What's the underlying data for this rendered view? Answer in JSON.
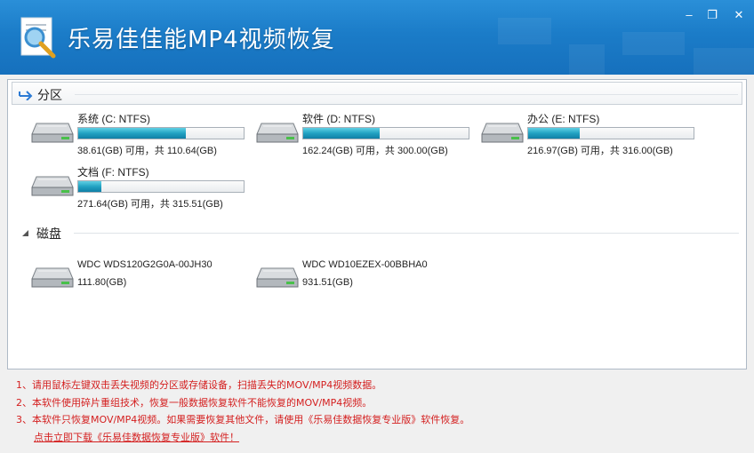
{
  "window": {
    "title": "乐易佳佳能MP4视频恢复",
    "minimize": "‒",
    "restore": "❐",
    "close": "✕",
    "colors": {
      "titlebar": "#1b7cc8",
      "bar_fill": "#22a2c2",
      "note_text": "#d42020"
    }
  },
  "partitions_group": {
    "label": "分区",
    "icon": "arrow-right-icon"
  },
  "partitions": [
    {
      "name": "系统 (C: NTFS)",
      "info": "38.61(GB) 可用，共 110.64(GB)",
      "used_fraction": 0.65
    },
    {
      "name": "软件 (D: NTFS)",
      "info": "162.24(GB) 可用，共 300.00(GB)",
      "used_fraction": 0.46
    },
    {
      "name": "办公 (E: NTFS)",
      "info": "216.97(GB) 可用，共 316.00(GB)",
      "used_fraction": 0.31
    },
    {
      "name": "文档 (F: NTFS)",
      "info": "271.64(GB) 可用，共 315.51(GB)",
      "used_fraction": 0.14
    }
  ],
  "disks_group": {
    "label": "磁盘",
    "icon": "triangle-collapse-icon"
  },
  "disks": [
    {
      "name": "WDC WDS120G2G0A-00JH30",
      "info": "111.80(GB)"
    },
    {
      "name": "WDC WD10EZEX-00BBHA0",
      "info": "931.51(GB)"
    }
  ],
  "notes": {
    "line1": "1、请用鼠标左键双击丢失视频的分区或存储设备，扫描丢失的MOV/MP4视频数据。",
    "line2": "2、本软件使用碎片重组技术，恢复一般数据恢复软件不能恢复的MOV/MP4视频。",
    "line3": "3、本软件只恢复MOV/MP4视频。如果需要恢复其他文件，请使用《乐易佳数据恢复专业版》软件恢复。",
    "download_link": "点击立即下载《乐易佳数据恢复专业版》软件！"
  }
}
